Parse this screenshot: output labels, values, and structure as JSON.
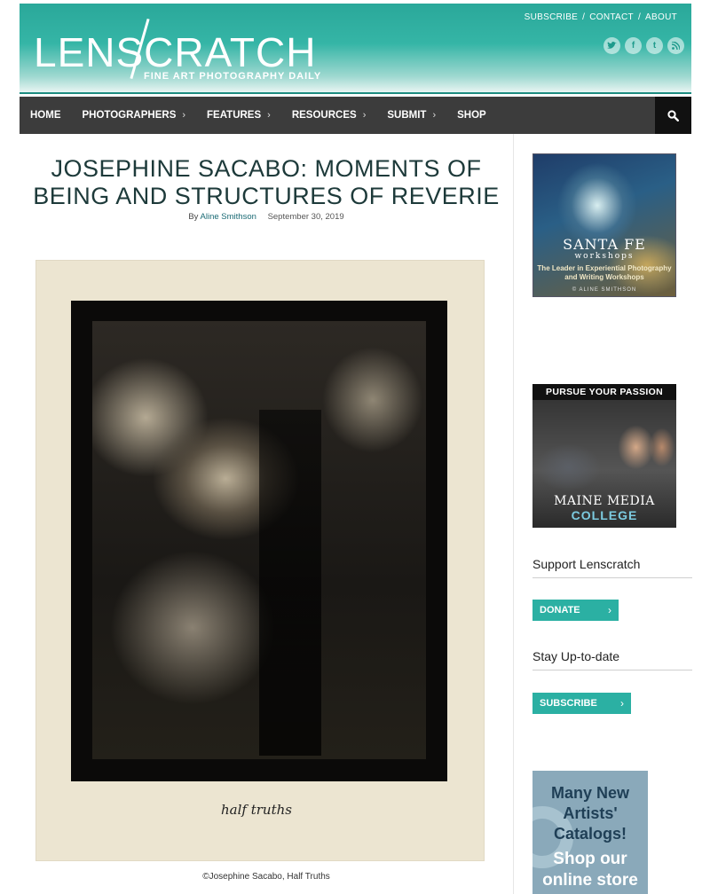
{
  "site": {
    "logo_text": "LENSCRATCH",
    "tagline": "FINE ART PHOTOGRAPHY DAILY",
    "top_links": [
      "SUBSCRIBE",
      "CONTACT",
      "ABOUT"
    ],
    "socials": [
      "twitter-icon",
      "facebook-icon",
      "tumblr-icon",
      "rss-icon"
    ],
    "accent_color": "#2bb0a3",
    "nav_background": "#3c3c3c"
  },
  "nav": {
    "items": [
      {
        "label": "HOME",
        "has_dropdown": false
      },
      {
        "label": "PHOTOGRAPHERS",
        "has_dropdown": true
      },
      {
        "label": "FEATURES",
        "has_dropdown": true
      },
      {
        "label": "RESOURCES",
        "has_dropdown": true
      },
      {
        "label": "SUBMIT",
        "has_dropdown": true
      },
      {
        "label": "SHOP",
        "has_dropdown": false
      }
    ],
    "search_icon": "search-icon"
  },
  "post": {
    "title": "JOSEPHINE SACABO: MOMENTS OF BEING AND STRUCTURES OF REVERIE",
    "by": "By",
    "author": "Aline Smithson",
    "date": "September 30, 2019",
    "photo_signature": "half truths",
    "caption": "©Josephine Sacabo, Half Truths"
  },
  "sidebar": {
    "ad1": {
      "title": "SANTA FE",
      "subtitle": "workshops",
      "line": "The Leader in Experiential Photography and Writing Workshops",
      "credit": "© ALINE SMITHSON"
    },
    "ad2": {
      "band": "PURSUE YOUR PASSION",
      "line1": "MAINE MEDIA",
      "line2": "COLLEGE"
    },
    "support_title": "Support Lenscratch",
    "donate_label": "DONATE",
    "stay_title": "Stay Up-to-date",
    "subscribe_label": "SUBSCRIBE",
    "ad3": {
      "line1": "Many New Artists' Catalogs!",
      "line2": "Shop our online store"
    }
  }
}
